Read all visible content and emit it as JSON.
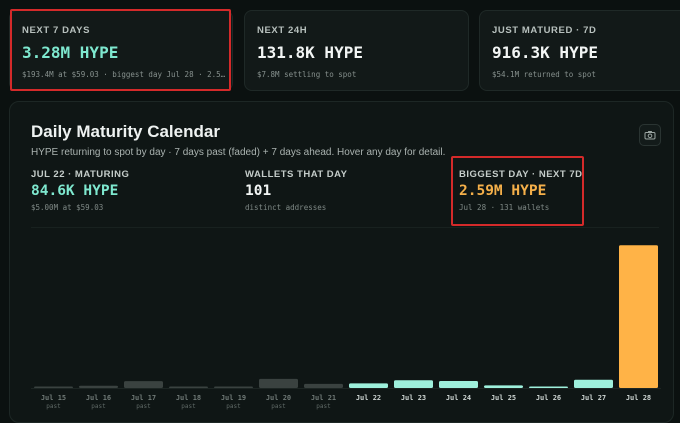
{
  "cards": [
    {
      "label": "NEXT 7 DAYS",
      "value": "3.28M HYPE",
      "sub": "$193.4M at $59.03 · biggest day Jul 28 · 2.5…",
      "value_color": "#7ee8cf"
    },
    {
      "label": "NEXT 24H",
      "value": "131.8K HYPE",
      "sub": "$7.8M settling to spot",
      "value_color": "#f2f5f4"
    },
    {
      "label": "JUST MATURED · 7D",
      "value": "916.3K HYPE",
      "sub": "$54.1M returned to spot",
      "value_color": "#f2f5f4"
    }
  ],
  "panel": {
    "title": "Daily Maturity Calendar",
    "description": "HYPE returning to spot by day · 7 days past (faded) + 7 days ahead. Hover any day for detail.",
    "camera_icon": "camera-icon"
  },
  "stats": [
    {
      "label": "JUL 22 · MATURING",
      "value": "84.6K HYPE",
      "sub": "$5.00M at $59.03",
      "color": "#7ee8cf"
    },
    {
      "label": "WALLETS THAT DAY",
      "value": "101",
      "sub": "distinct addresses",
      "color": "#f2f5f4"
    },
    {
      "label": "BIGGEST DAY · NEXT 7D",
      "value": "2.59M HYPE",
      "sub": "Jul 28 · 131 wallets",
      "color": "#f5b04a"
    }
  ],
  "colors": {
    "past": "#3a4240",
    "upcoming": "#9ef0dc",
    "biggest": "#ffb347",
    "highlight": "#d42a2a"
  },
  "chart_data": {
    "type": "bar",
    "categories": [
      "Jul 15",
      "Jul 16",
      "Jul 17",
      "Jul 18",
      "Jul 19",
      "Jul 20",
      "Jul 21",
      "Jul 22",
      "Jul 23",
      "Jul 24",
      "Jul 25",
      "Jul 26",
      "Jul 27",
      "Jul 28"
    ],
    "sublabels": [
      "past",
      "past",
      "past",
      "past",
      "past",
      "past",
      "past",
      "",
      "",
      "",
      "",
      "",
      "",
      ""
    ],
    "values": [
      18000,
      40000,
      125000,
      25000,
      12000,
      165000,
      75000,
      84600,
      140000,
      128000,
      48000,
      18000,
      150000,
      2590000
    ],
    "status": [
      "past",
      "past",
      "past",
      "past",
      "past",
      "past",
      "past",
      "upcoming",
      "upcoming",
      "upcoming",
      "upcoming",
      "upcoming",
      "upcoming",
      "biggest"
    ],
    "ylim": [
      0,
      2650000
    ]
  }
}
